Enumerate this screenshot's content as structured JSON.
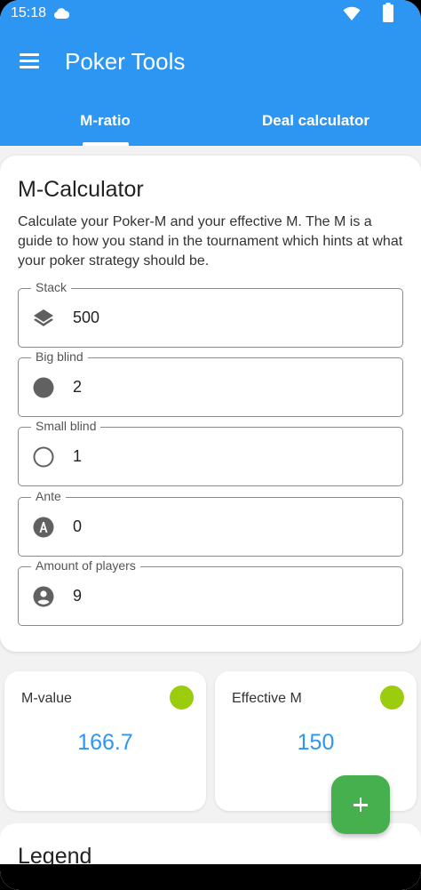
{
  "status_bar": {
    "time": "15:18",
    "icons": [
      "cloud-icon",
      "wifi-icon",
      "battery-icon"
    ]
  },
  "app_bar": {
    "title": "Poker Tools",
    "menu_icon": "menu-icon"
  },
  "tabs": [
    {
      "label": "M-ratio",
      "selected": true
    },
    {
      "label": "Deal calculator",
      "selected": false
    }
  ],
  "calculator": {
    "title": "M-Calculator",
    "description": "Calculate your Poker-M and your effective M. The M is a guide to how you stand in the tournament which hints at what your poker strategy should be.",
    "fields": [
      {
        "label": "Stack",
        "value": "500",
        "icon": "stack-icon"
      },
      {
        "label": "Big blind",
        "value": "2",
        "icon": "big-blind-icon"
      },
      {
        "label": "Small blind",
        "value": "1",
        "icon": "small-blind-icon"
      },
      {
        "label": "Ante",
        "value": "0",
        "icon": "ante-icon"
      },
      {
        "label": "Amount of players",
        "value": "9",
        "icon": "players-icon"
      }
    ]
  },
  "results": {
    "m_value": {
      "label": "M-value",
      "value": "166.7"
    },
    "effective_m": {
      "label": "Effective M",
      "value": "150"
    },
    "status_color": "#9bcc0e"
  },
  "fab": {
    "icon": "plus-icon"
  },
  "legend": {
    "title": "Legend"
  },
  "colors": {
    "primary": "#2d96f3",
    "fab": "#45b04d",
    "status": "#9bcc0e"
  }
}
